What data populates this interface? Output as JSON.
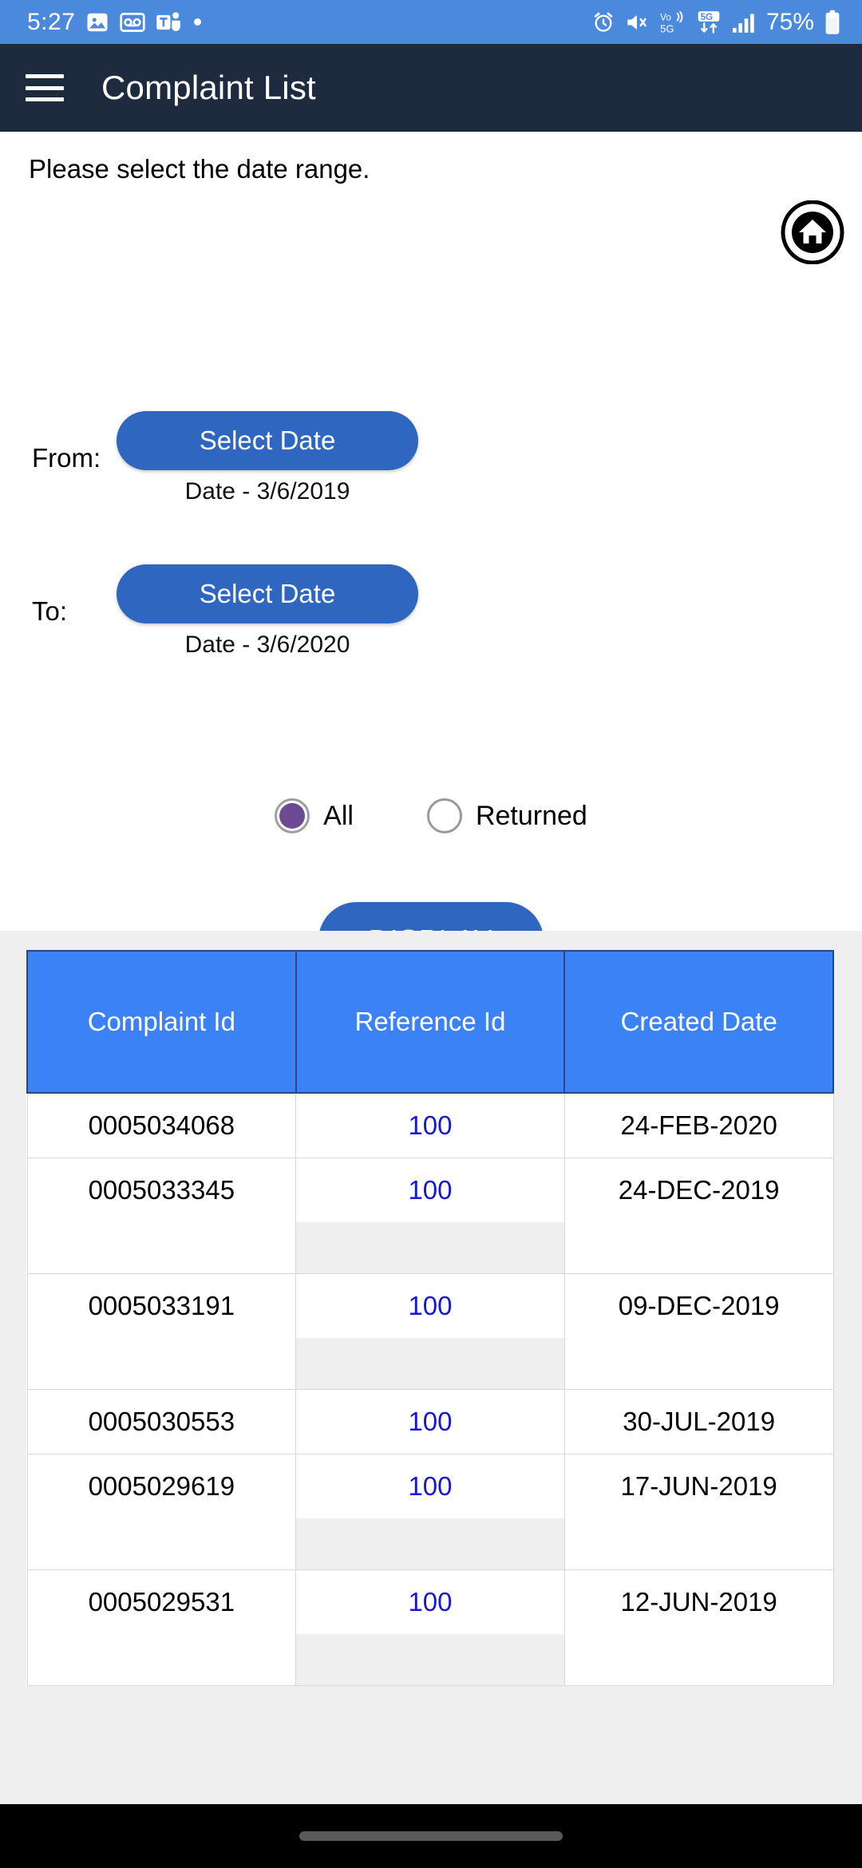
{
  "status_bar": {
    "time": "5:27",
    "battery_percent": "75%",
    "left_icons": [
      "photo-icon",
      "voicemail-icon",
      "teams-icon",
      "dot-badge-icon"
    ],
    "right_icons": [
      "alarm-icon",
      "mute-vibrate-icon",
      "volte-5g-icon",
      "5g-data-icon",
      "signal-bars-icon",
      "battery-icon"
    ],
    "background_color": "#4a89dc"
  },
  "app_bar": {
    "title": "Complaint List",
    "menu_icon": "hamburger-icon",
    "background_color": "#1e2a3d"
  },
  "form": {
    "hint": "Please select the date range.",
    "home_icon": "home-icon",
    "from": {
      "label": "From:",
      "button_label": "Select Date",
      "value_caption": "Date - 3/6/2019"
    },
    "to": {
      "label": "To:",
      "button_label": "Select Date",
      "value_caption": "Date - 3/6/2020"
    },
    "radios": [
      {
        "label": "All",
        "checked": true
      },
      {
        "label": "Returned",
        "checked": false
      }
    ],
    "display_button": "DISPLAY",
    "download_button_icon": "download-icon",
    "accent_blue": "#2f66c0",
    "radio_selected_color": "#6d4a94",
    "download_green": "#2f7d20"
  },
  "table": {
    "header_color": "#3b82f6",
    "columns": [
      "Complaint Id",
      "Reference Id",
      "Created Date"
    ],
    "rows": [
      {
        "complaint_id": "0005034068",
        "reference_id": "100",
        "created_date": "24-FEB-2020",
        "tall": false
      },
      {
        "complaint_id": "0005033345",
        "reference_id": "100",
        "created_date": "24-DEC-2019",
        "tall": true
      },
      {
        "complaint_id": "0005033191",
        "reference_id": "100",
        "created_date": "09-DEC-2019",
        "tall": true
      },
      {
        "complaint_id": "0005030553",
        "reference_id": "100",
        "created_date": "30-JUL-2019",
        "tall": false
      },
      {
        "complaint_id": "0005029619",
        "reference_id": "100",
        "created_date": "17-JUN-2019",
        "tall": true
      },
      {
        "complaint_id": "0005029531",
        "reference_id": "100",
        "created_date": "12-JUN-2019",
        "tall": true
      }
    ]
  },
  "nav_bar": {
    "gesture_pill": "gesture-pill"
  }
}
